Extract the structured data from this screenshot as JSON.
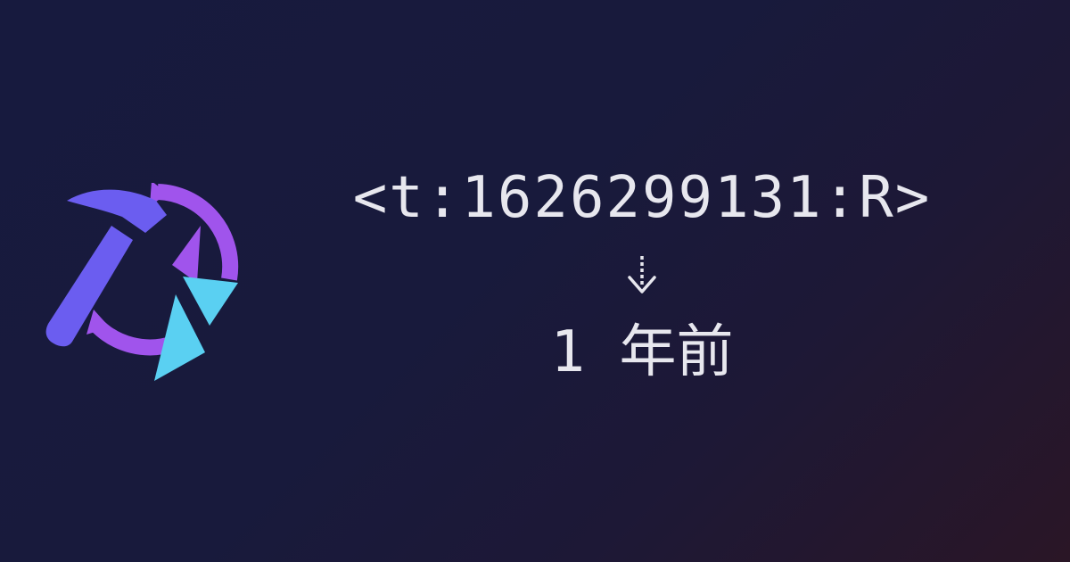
{
  "logo": {
    "icon": "hammer-clock-icon",
    "colors": {
      "hammer": "#6b5df0",
      "ring": "#a054ec",
      "shards": "#5ad0f2"
    }
  },
  "timestamp_code": "<t:1626299131:R>",
  "arrow_icon": "dashed-down-arrow-icon",
  "relative_time": "1 年前",
  "colors": {
    "background_start": "#171a3e",
    "background_end": "#2a1626",
    "text": "#e7e7ee"
  }
}
